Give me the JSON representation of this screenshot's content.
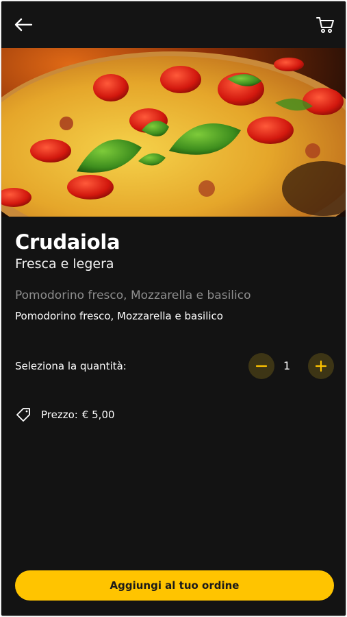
{
  "header": {
    "back_icon": "arrow-left-icon",
    "cart_icon": "shopping-cart-icon"
  },
  "product": {
    "image_alt": "pizza",
    "name": "Crudaiola",
    "tagline": "Fresca e legera",
    "ingredients_muted": "Pomodorino fresco, Mozzarella e basilico",
    "ingredients": "Pomodorino fresco, Mozzarella e basilico"
  },
  "quantity": {
    "label": "Seleziona la quantità:",
    "value": "1",
    "minus_icon": "minus-icon",
    "plus_icon": "plus-icon"
  },
  "price": {
    "icon": "price-tag-icon",
    "label": "Prezzo:",
    "value": "€ 5,00"
  },
  "cta": {
    "label": "Aggiungi al tuo ordine"
  },
  "colors": {
    "background": "#131313",
    "accent": "#ffc400",
    "qty_button_bg": "#3d3515",
    "muted_text": "#8e8e8e"
  }
}
